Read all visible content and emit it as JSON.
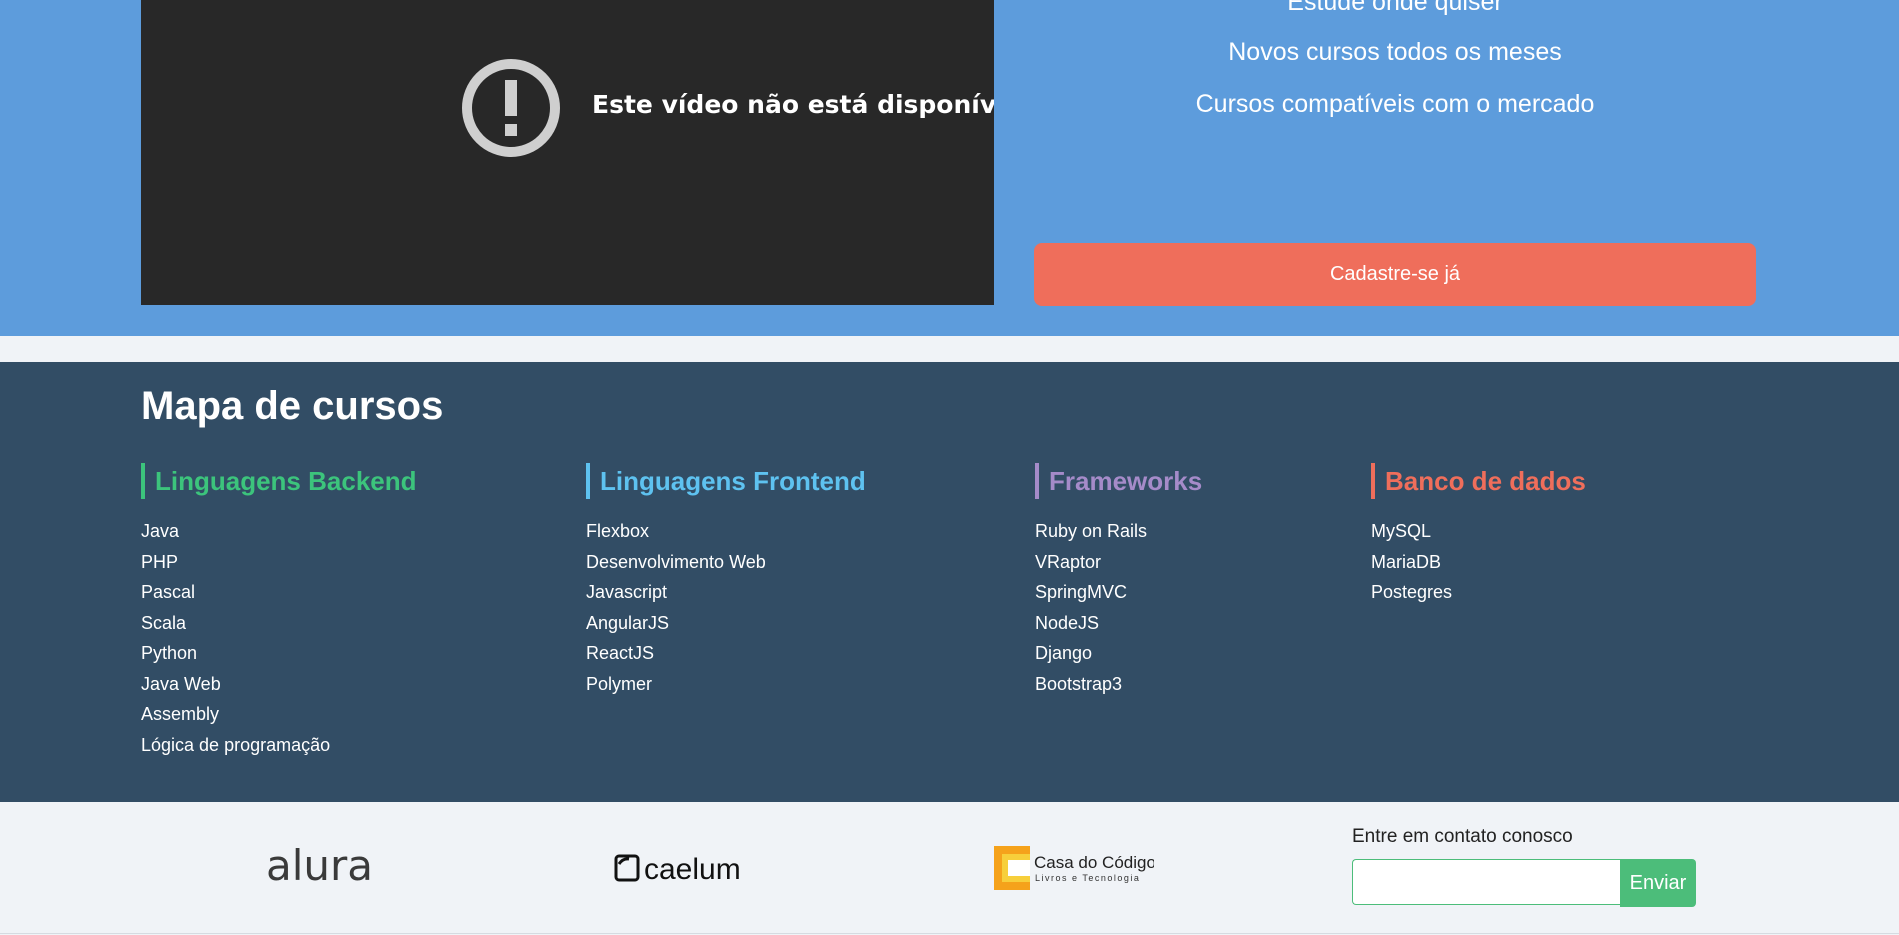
{
  "hero": {
    "video_message": "Este vídeo não está disponível",
    "features": [
      "Estude onde quiser",
      "Novos cursos todos os meses",
      "Cursos compatíveis com o mercado"
    ],
    "signup_label": "Cadastre-se já"
  },
  "map": {
    "title": "Mapa de cursos",
    "columns": [
      {
        "title": "Linguagens Backend",
        "color": "#3cc47c",
        "items": [
          "Java",
          "PHP",
          "Pascal",
          "Scala",
          "Python",
          "Java Web",
          "Assembly",
          "Lógica de programação"
        ]
      },
      {
        "title": "Linguagens Frontend",
        "color": "#5ec2f0",
        "items": [
          "Flexbox",
          "Desenvolvimento Web",
          "Javascript",
          "AngularJS",
          "ReactJS",
          "Polymer"
        ]
      },
      {
        "title": "Frameworks",
        "color": "#a58bc9",
        "items": [
          "Ruby on Rails",
          "VRaptor",
          "SpringMVC",
          "NodeJS",
          "Django",
          "Bootstrap3"
        ]
      },
      {
        "title": "Banco de dados",
        "color": "#ef6e5b",
        "items": [
          "MySQL",
          "MariaDB",
          "Postegres"
        ]
      }
    ]
  },
  "footer": {
    "logos": {
      "alura": "alura",
      "caelum": "caelum",
      "casa_title": "Casa do Código",
      "casa_subtitle": "Livros e Tecnologia"
    },
    "contact_label": "Entre em contato conosco",
    "contact_placeholder": "",
    "send_label": "Enviar"
  }
}
